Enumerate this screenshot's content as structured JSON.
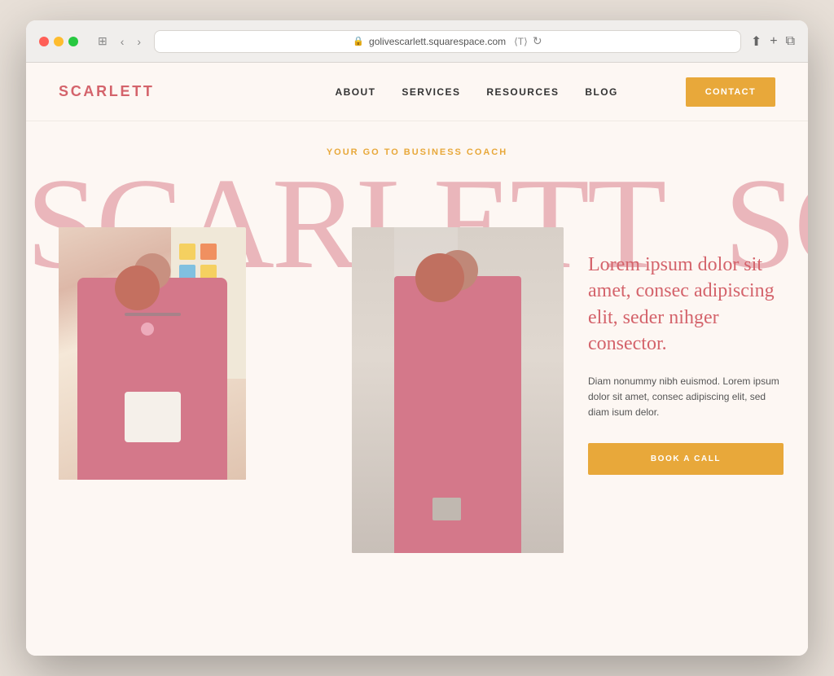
{
  "browser": {
    "url": "golivescarlett.squarespace.com",
    "traffic_lights": [
      "red",
      "yellow",
      "green"
    ]
  },
  "nav": {
    "logo": "SCARLETT",
    "links": [
      "ABOUT",
      "SERVICES",
      "RESOURCES",
      "BLOG"
    ],
    "contact_button": "CONTACT"
  },
  "hero": {
    "tagline": "YOUR GO TO BUSINESS COACH",
    "big_text": "SCARLETT",
    "headline": "Lorem ipsum dolor sit amet, consec adipiscing elit, seder nihger consector.",
    "body": "Diam nonummy nibh euismod. Lorem ipsum dolor sit amet, consec adipiscing elit, sed diam isum delor.",
    "cta_button": "BOOK A CALL"
  },
  "colors": {
    "brand_pink": "#d4636b",
    "accent_gold": "#e8a83a",
    "bg": "#fdf7f3",
    "text_dark": "#333333",
    "text_medium": "#555555"
  }
}
